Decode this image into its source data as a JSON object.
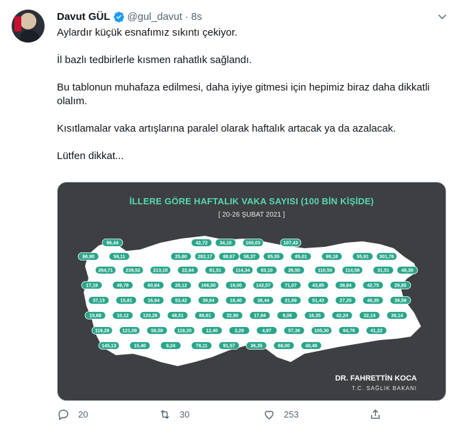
{
  "tweet": {
    "author_name": "Davut GÜL",
    "handle": "@gul_davut",
    "separator": "·",
    "time": "8s",
    "paragraphs": [
      "Aylardır küçük esnafımız sıkıntı çekiyor.",
      "İl bazlı tedbirlerle kısmen rahatlık sağlandı.",
      "Bu tablonun muhafaza edilmesi, daha iyiye gitmesi için hepimiz biraz daha dikkatli olalım.",
      "Kısıtlamalar vaka artışlarına paralel olarak haftalık artacak ya da azalacak.",
      "Lütfen dikkat..."
    ]
  },
  "image": {
    "title": "İLLERE GÖRE HAFTALIK VAKA SAYISI (100 BİN KİŞİDE)",
    "date_range": "[ 20-26 ŞUBAT 2021 ]",
    "credit_name": "DR. FAHRETTİN KOCA",
    "credit_org": "T.C. SAĞLIK BAKANI",
    "badges": [
      "96,44",
      "42,72",
      "34,10",
      "160,03",
      "107,43",
      "86,90",
      "59,11",
      "25,80",
      "282,17",
      "88,67",
      "58,37",
      "85,55",
      "85,01",
      "99,18",
      "55,91",
      "301,76",
      "264,71",
      "239,52",
      "213,10",
      "22,84",
      "81,51",
      "114,34",
      "83,10",
      "26,50",
      "110,50",
      "114,58",
      "31,51",
      "48,30",
      "17,19",
      "49,78",
      "60,84",
      "28,12",
      "166,50",
      "19,00",
      "142,57",
      "71,07",
      "43,85",
      "39,84",
      "42,75",
      "29,85",
      "37,13",
      "15,81",
      "16,64",
      "53,42",
      "39,64",
      "18,40",
      "38,44",
      "21,69",
      "51,43",
      "27,25",
      "46,35",
      "39,58",
      "15,68",
      "10,12",
      "120,26",
      "48,51",
      "88,81",
      "32,90",
      "17,94",
      "8,06",
      "16,35",
      "42,24",
      "32,14",
      "39,14",
      "119,28",
      "121,08",
      "58,59",
      "118,20",
      "12,40",
      "2,29",
      "4,97",
      "57,36",
      "105,30",
      "64,76",
      "41,22",
      "145,13",
      "15,40",
      "9,24",
      "78,11",
      "91,57",
      "36,35",
      "68,00",
      "40,46"
    ]
  },
  "actions": {
    "replies": "20",
    "retweets": "30",
    "likes": "253"
  },
  "colors": {
    "accent": "#1d9bf0",
    "map_background": "#3d3f42",
    "badge": "#2aa58a",
    "title": "#57d9b0"
  }
}
